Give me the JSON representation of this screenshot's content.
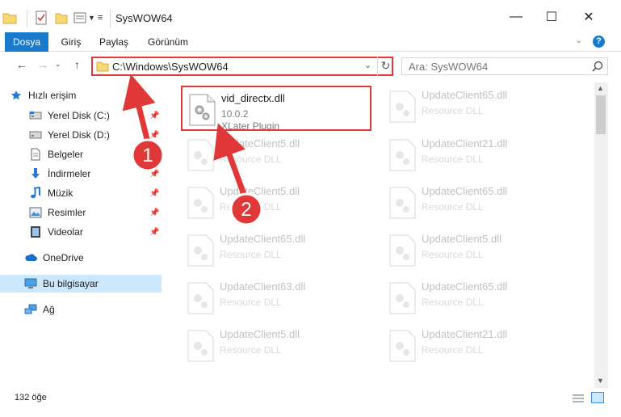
{
  "window": {
    "title": "SysWOW64",
    "minimize": "—",
    "maximize": "☐",
    "close": "✕"
  },
  "ribbon": {
    "tabs": [
      "Dosya",
      "Giriş",
      "Paylaş",
      "Görünüm"
    ],
    "help": "?"
  },
  "nav": {
    "address": "C:\\Windows\\SysWOW64",
    "search_placeholder": "Ara: SysWOW64"
  },
  "sidebar": {
    "items": [
      {
        "label": "Hızlı erişim",
        "icon": "star-icon"
      },
      {
        "label": "Yerel Disk (C:)",
        "icon": "drive-icon"
      },
      {
        "label": "Yerel Disk (D:)",
        "icon": "drive-icon"
      },
      {
        "label": "Belgeler",
        "icon": "document-icon"
      },
      {
        "label": "İndirmeler",
        "icon": "download-icon"
      },
      {
        "label": "Müzik",
        "icon": "music-icon"
      },
      {
        "label": "Resimler",
        "icon": "pictures-icon"
      },
      {
        "label": "Videolar",
        "icon": "video-icon"
      },
      {
        "label": "OneDrive",
        "icon": "cloud-icon"
      },
      {
        "label": "Bu bilgisayar",
        "icon": "computer-icon"
      },
      {
        "label": "Ağ",
        "icon": "network-icon"
      }
    ]
  },
  "files": {
    "main": {
      "name": "vid_directx.dll",
      "version": "10.0.2",
      "description": "XLater Plugin"
    },
    "items": [
      {
        "name": "UpdateClient65.dll",
        "type": "Resource DLL"
      },
      {
        "name": "UpdateClient5.dll",
        "type": "Resource DLL"
      },
      {
        "name": "UpdateClient21.dll",
        "type": "Resource DLL"
      },
      {
        "name": "UpdateClient5.dll",
        "type": "Resource DLL"
      },
      {
        "name": "UpdateClient65.dll",
        "type": "Resource DLL"
      },
      {
        "name": "UpdateClient65.dll",
        "type": "Resource DLL"
      },
      {
        "name": "UpdateClient5.dll",
        "type": "Resource DLL"
      },
      {
        "name": "UpdateClient63.dll",
        "type": "Resource DLL"
      },
      {
        "name": "UpdateClient65.dll",
        "type": "Resource DLL"
      },
      {
        "name": "UpdateClient5.dll",
        "type": "Resource DLL"
      },
      {
        "name": "UpdateClient21.dll",
        "type": "Resource DLL"
      }
    ]
  },
  "status": {
    "count": "132 öğe"
  },
  "annotations": {
    "step1": "1",
    "step2": "2",
    "color": "#e03838"
  },
  "colors": {
    "accent": "#1979ca",
    "selection": "#cce8ff",
    "highlight": "#e03838"
  }
}
